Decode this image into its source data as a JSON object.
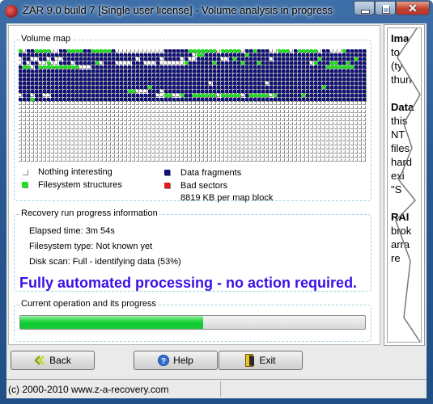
{
  "window": {
    "title": "ZAR 9.0 build 7 [Single user license] - Volume analysis in progress",
    "controls": {
      "minimize": "minimize",
      "maximize": "maximize",
      "close": "✕"
    }
  },
  "volume_map": {
    "label": "Volume map",
    "columns": 86,
    "rows_total": 28,
    "cell_codes": {
      "0": "nothing-interesting",
      "1": "data-fragment",
      "2": "filesystem-structure",
      "3": "bad-sector"
    },
    "rows": [
      "20112222001122221122222100000000000011111122222220222220112111002220122222011000211111111",
      "11111111111111111111111111111111111111111110221111111111211111111111111111111111111111111",
      "01100110100111111111111111111011111011110100111111001211111111011111111111211111111211111",
      "01011002001110111112011100001110001000000211111121111112111211111111111102111221121111211",
      "12201222222222200011111111111111111111111111111111111111111111111111111111112222222111111",
      "11111111111111111111111111111111111111111111111111111111111111111111111111111111111111111",
      "11111111111111111111111111111111111111111111111111111111111111111111111111111111111111111",
      "11111111111111111111111111111111111111111111111111111111111111111111111111111111111111111",
      "11111111111111111111111111111111111111111111111011111111111110111111111111111111111111111",
      "11111111111111111111111111111111211111111111111111111111111111111111111111121111111111111",
      "11111111111111111111111111122000111011111111111111111111111111111111111111111111111111111",
      "01101100111111111111111111111111110022002112222220222220122222021111112111111111111111111",
      "11121111111111111111111111111111111111111111111111111111111111111111111111111111111111111",
      "00000000000000000000000000000000000000000000000000000000000000000000000000000000000000000"
    ],
    "legend": [
      {
        "label": "Nothing interesting",
        "color": "#ffffff"
      },
      {
        "label": "Filesystem structures",
        "color": "#19e619"
      },
      {
        "label": "Data fragments",
        "color": "#10107a"
      },
      {
        "label": "Bad sectors",
        "color": "#e61a1a"
      }
    ],
    "block_size_note": "8819 KB per map block"
  },
  "recovery_info": {
    "label": "Recovery run progress information",
    "elapsed": "Elapsed time: 3m 54s",
    "filesystem": "Filesystem type: Not known yet",
    "disk_scan": "Disk scan: Full - identifying data (53%)",
    "banner": "Fully automated processing - no action required.",
    "banner_color": "#3a10e6"
  },
  "current_operation": {
    "label": "Current operation and its progress",
    "progress_percent": 53
  },
  "side_panel": {
    "lines": [
      {
        "text": "Ima",
        "bold": true
      },
      {
        "text": "to",
        "bold": false
      },
      {
        "text": "(ty",
        "bold": false
      },
      {
        "text": "thun",
        "bold": false
      },
      {
        "text": "",
        "bold": false
      },
      {
        "text": "Data",
        "bold": true
      },
      {
        "text": "this",
        "bold": false
      },
      {
        "text": "NT",
        "bold": false
      },
      {
        "text": "files",
        "bold": false
      },
      {
        "text": "hard",
        "bold": false
      },
      {
        "text": "exi",
        "bold": false
      },
      {
        "text": "\"S",
        "bold": false
      },
      {
        "text": "",
        "bold": false
      },
      {
        "text": "RAI",
        "bold": true
      },
      {
        "text": "brok",
        "bold": false
      },
      {
        "text": "arra",
        "bold": false
      },
      {
        "text": "re",
        "bold": false
      }
    ]
  },
  "buttons": {
    "back": "Back",
    "help": "Help",
    "exit": "Exit"
  },
  "statusbar": {
    "text": "(c) 2000-2010 www.z-a-recovery.com"
  }
}
